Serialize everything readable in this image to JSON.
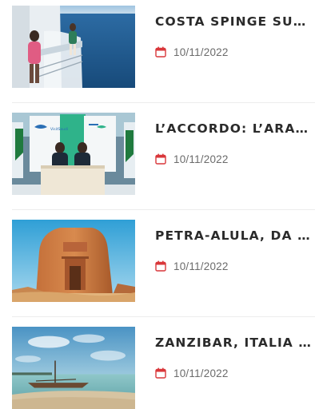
{
  "news": {
    "items": [
      {
        "title": "COSTA SPINGE SUL BRANDING",
        "date": "10/11/2022",
        "thumbnail": "cruise-ship-deck-photo"
      },
      {
        "title": "L’ACCORDO: L’ARABIA SAUDITA",
        "date": "10/11/2022",
        "thumbnail": "signing-ceremony-photo"
      },
      {
        "title": "PETRA-ALULA, DA GEMELLE",
        "date": "10/11/2022",
        "thumbnail": "desert-rock-tomb-photo"
      },
      {
        "title": "ZANZIBAR, ITALIA PRIMO MERCATO",
        "date": "10/11/2022",
        "thumbnail": "beach-boat-sunset-photo"
      }
    ],
    "date_icon": "calendar-icon",
    "accent_color": "#d9373a"
  }
}
